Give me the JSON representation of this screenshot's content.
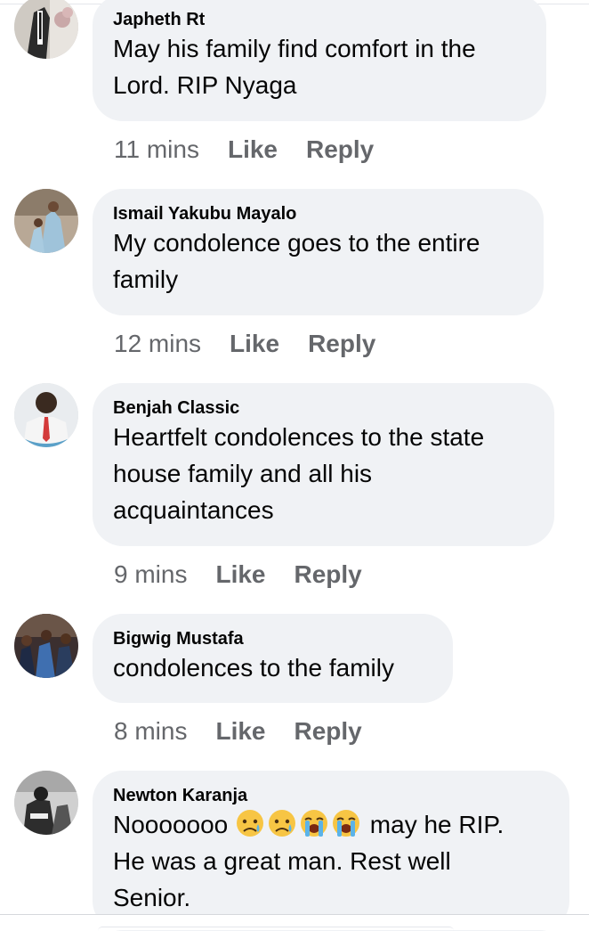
{
  "comments": [
    {
      "author": "Japheth Rt",
      "lines": [
        "May his family find comfort in the",
        "Lord. RIP Nyaga"
      ],
      "time": "11 mins",
      "like": "Like",
      "reply": "Reply"
    },
    {
      "author": "Ismail Yakubu Mayalo",
      "lines": [
        "My condolence goes to the entire",
        "family"
      ],
      "time": "12 mins",
      "like": "Like",
      "reply": "Reply"
    },
    {
      "author": "Benjah Classic",
      "lines": [
        "Heartfelt condolences to the state",
        "house family and all his",
        "acquaintances"
      ],
      "time": "9 mins",
      "like": "Like",
      "reply": "Reply"
    },
    {
      "author": "Bigwig Mustafa",
      "lines": [
        "condolences to the family"
      ],
      "time": "8 mins",
      "like": "Like",
      "reply": "Reply"
    },
    {
      "author": "Newton Karanja",
      "line1_start": "Nooooooo",
      "line1_end": "may he RIP.",
      "emojis": [
        "sad-but-relieved-face",
        "sad-but-relieved-face",
        "loudly-crying-face",
        "loudly-crying-face"
      ],
      "lines": [
        "He was a great man. Rest well",
        "Senior."
      ]
    }
  ],
  "colors": {
    "bubble": "#f0f2f5",
    "text": "#050505",
    "meta": "#65676b"
  }
}
